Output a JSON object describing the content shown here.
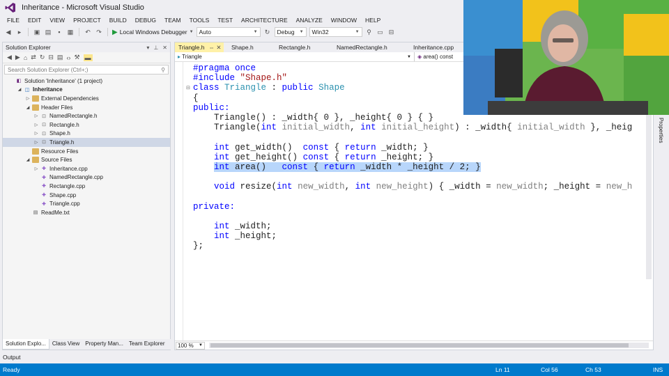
{
  "window": {
    "title": "Inheritance - Microsoft Visual Studio"
  },
  "menu": [
    "FILE",
    "EDIT",
    "VIEW",
    "PROJECT",
    "BUILD",
    "DEBUG",
    "TEAM",
    "TOOLS",
    "TEST",
    "ARCHITECTURE",
    "ANALYZE",
    "WINDOW",
    "HELP"
  ],
  "toolbar": {
    "debugger_label": "Local Windows Debugger",
    "config_combo": "Auto",
    "build_config": "Debug",
    "platform": "Win32"
  },
  "solution_explorer": {
    "title": "Solution Explorer",
    "search_placeholder": "Search Solution Explorer (Ctrl+;)",
    "tree": [
      {
        "label": "Solution 'Inheritance' (1 project)",
        "icon": "solution-icon",
        "indent": 0,
        "arrow": "",
        "bold": false
      },
      {
        "label": "Inheritance",
        "icon": "project-icon",
        "indent": 1,
        "arrow": "expanded",
        "bold": true
      },
      {
        "label": "External Dependencies",
        "icon": "folder-icon",
        "indent": 2,
        "arrow": "collapsed",
        "bold": false
      },
      {
        "label": "Header Files",
        "icon": "folder-icon",
        "indent": 2,
        "arrow": "expanded",
        "bold": false
      },
      {
        "label": "NamedRectangle.h",
        "icon": "header-file-icon",
        "indent": 3,
        "arrow": "collapsed",
        "bold": false
      },
      {
        "label": "Rectangle.h",
        "icon": "header-file-icon",
        "indent": 3,
        "arrow": "collapsed",
        "bold": false
      },
      {
        "label": "Shape.h",
        "icon": "header-file-icon",
        "indent": 3,
        "arrow": "collapsed",
        "bold": false
      },
      {
        "label": "Triangle.h",
        "icon": "header-file-icon",
        "indent": 3,
        "arrow": "collapsed",
        "bold": false,
        "selected": true
      },
      {
        "label": "Resource Files",
        "icon": "folder-icon",
        "indent": 2,
        "arrow": "",
        "bold": false
      },
      {
        "label": "Source Files",
        "icon": "folder-icon",
        "indent": 2,
        "arrow": "expanded",
        "bold": false
      },
      {
        "label": "Inheritance.cpp",
        "icon": "cpp-file-icon",
        "indent": 3,
        "arrow": "collapsed",
        "bold": false
      },
      {
        "label": "NamedRectangle.cpp",
        "icon": "cpp-file-icon",
        "indent": 3,
        "arrow": "",
        "bold": false
      },
      {
        "label": "Rectangle.cpp",
        "icon": "cpp-file-icon",
        "indent": 3,
        "arrow": "",
        "bold": false
      },
      {
        "label": "Shape.cpp",
        "icon": "cpp-file-icon",
        "indent": 3,
        "arrow": "",
        "bold": false
      },
      {
        "label": "Triangle.cpp",
        "icon": "cpp-file-icon",
        "indent": 3,
        "arrow": "",
        "bold": false
      },
      {
        "label": "ReadMe.txt",
        "icon": "text-file-icon",
        "indent": 2,
        "arrow": "",
        "bold": false
      }
    ],
    "bottom_tabs": [
      "Solution Explo...",
      "Class View",
      "Property Man...",
      "Team Explorer"
    ]
  },
  "editor": {
    "tabs": [
      "Triangle.h",
      "Shape.h",
      "Rectangle.h",
      "NamedRectangle.h",
      "Inheritance.cpp"
    ],
    "nav_scope": "Triangle",
    "nav_member": "area() const",
    "zoom": "100 %",
    "code": [
      [
        {
          "t": "#pragma once",
          "c": "pp"
        }
      ],
      [
        {
          "t": "#include ",
          "c": "pp"
        },
        {
          "t": "\"Shape.h\"",
          "c": "str"
        }
      ],
      [
        {
          "t": "class ",
          "c": "kw"
        },
        {
          "t": "Triangle",
          "c": "typ"
        },
        {
          "t": " : ",
          "c": ""
        },
        {
          "t": "public ",
          "c": "kw"
        },
        {
          "t": "Shape",
          "c": "typ"
        }
      ],
      [
        {
          "t": "{",
          "c": ""
        }
      ],
      [
        {
          "t": "public:",
          "c": "kw"
        }
      ],
      [
        {
          "t": "    Triangle() : _width{ 0 }, _height{ 0 } { }",
          "c": ""
        }
      ],
      [
        {
          "t": "    Triangle(",
          "c": ""
        },
        {
          "t": "int ",
          "c": "kw"
        },
        {
          "t": "initial_width",
          "c": "prm"
        },
        {
          "t": ", ",
          "c": ""
        },
        {
          "t": "int ",
          "c": "kw"
        },
        {
          "t": "initial_height",
          "c": "prm"
        },
        {
          "t": ") : _width{ ",
          "c": ""
        },
        {
          "t": "initial_width",
          "c": "prm"
        },
        {
          "t": " }, _heig",
          "c": ""
        }
      ],
      [
        {
          "t": "",
          "c": ""
        }
      ],
      [
        {
          "t": "    ",
          "c": ""
        },
        {
          "t": "int ",
          "c": "kw"
        },
        {
          "t": "get_width()  ",
          "c": ""
        },
        {
          "t": "const ",
          "c": "kw"
        },
        {
          "t": "{ ",
          "c": ""
        },
        {
          "t": "return ",
          "c": "kw"
        },
        {
          "t": "_width; }",
          "c": ""
        }
      ],
      [
        {
          "t": "    ",
          "c": ""
        },
        {
          "t": "int ",
          "c": "kw"
        },
        {
          "t": "get_height() ",
          "c": ""
        },
        {
          "t": "const ",
          "c": "kw"
        },
        {
          "t": "{ ",
          "c": ""
        },
        {
          "t": "return ",
          "c": "kw"
        },
        {
          "t": "_height; }",
          "c": ""
        }
      ],
      [
        {
          "t": "    ",
          "c": ""
        },
        {
          "t": "int ",
          "c": "kw sel"
        },
        {
          "t": "area()   ",
          "c": "sel"
        },
        {
          "t": "const ",
          "c": "kw sel"
        },
        {
          "t": "{ ",
          "c": "sel"
        },
        {
          "t": "return ",
          "c": "kw sel"
        },
        {
          "t": "_width * _height / 2; }",
          "c": "sel"
        }
      ],
      [
        {
          "t": "",
          "c": ""
        }
      ],
      [
        {
          "t": "    ",
          "c": ""
        },
        {
          "t": "void ",
          "c": "kw"
        },
        {
          "t": "resize(",
          "c": ""
        },
        {
          "t": "int ",
          "c": "kw"
        },
        {
          "t": "new_width",
          "c": "prm"
        },
        {
          "t": ", ",
          "c": ""
        },
        {
          "t": "int ",
          "c": "kw"
        },
        {
          "t": "new_height",
          "c": "prm"
        },
        {
          "t": ") { _width = ",
          "c": ""
        },
        {
          "t": "new_width",
          "c": "prm"
        },
        {
          "t": "; _height = ",
          "c": ""
        },
        {
          "t": "new_h",
          "c": "prm"
        }
      ],
      [
        {
          "t": "",
          "c": ""
        }
      ],
      [
        {
          "t": "private:",
          "c": "kw"
        }
      ],
      [
        {
          "t": "",
          "c": ""
        }
      ],
      [
        {
          "t": "    ",
          "c": ""
        },
        {
          "t": "int ",
          "c": "kw"
        },
        {
          "t": "_width;",
          "c": ""
        }
      ],
      [
        {
          "t": "    ",
          "c": ""
        },
        {
          "t": "int ",
          "c": "kw"
        },
        {
          "t": "_height;",
          "c": ""
        }
      ],
      [
        {
          "t": "};",
          "c": ""
        }
      ]
    ]
  },
  "side_panel": {
    "properties_label": "Properties"
  },
  "output": {
    "label": "Output"
  },
  "status": {
    "ready": "Ready",
    "line": "Ln 11",
    "col": "Col 56",
    "ch": "Ch 53",
    "mode": "INS"
  },
  "colors": {
    "status_bar": "#007acc",
    "selection": "#b8d6fb",
    "keyword": "#0000ff",
    "type": "#2b91af"
  }
}
